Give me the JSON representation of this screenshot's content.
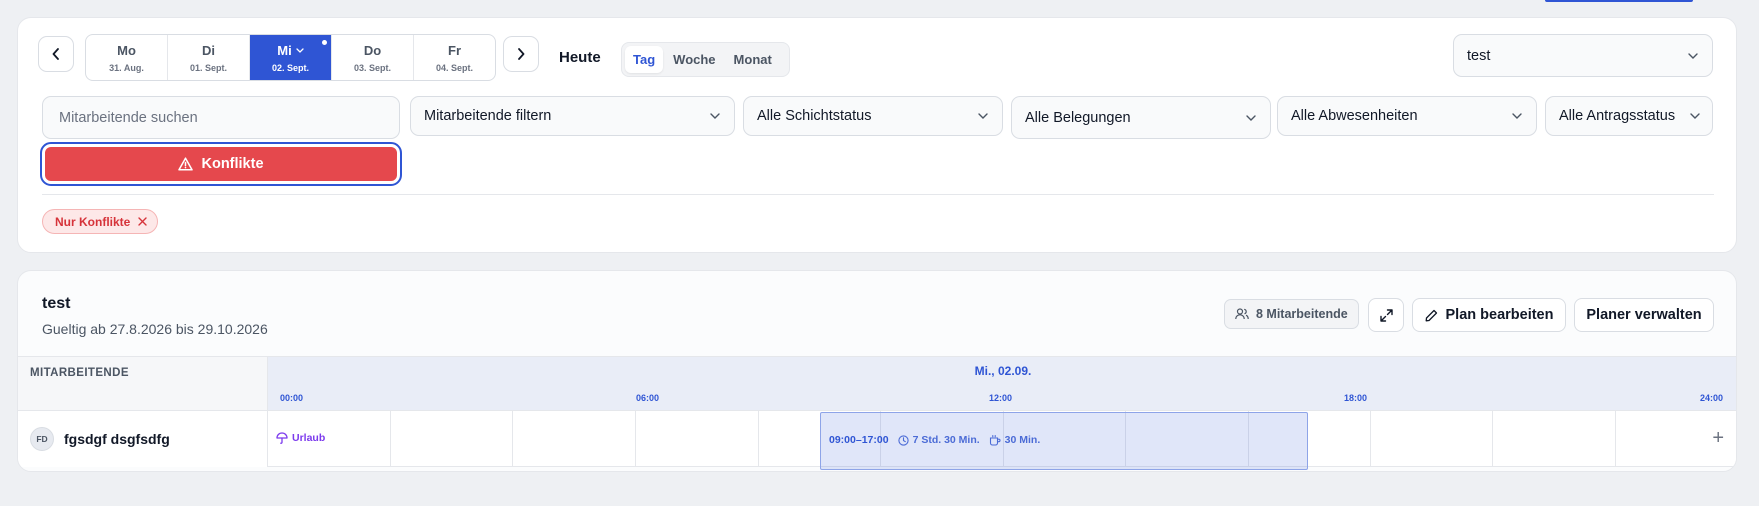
{
  "toolbar": {
    "days": [
      {
        "name": "Mo",
        "date": "31. Aug."
      },
      {
        "name": "Di",
        "date": "01. Sept."
      },
      {
        "name": "Mi",
        "date": "02. Sept."
      },
      {
        "name": "Do",
        "date": "03. Sept."
      },
      {
        "name": "Fr",
        "date": "04. Sept."
      }
    ],
    "active_day_index": 2,
    "today_label": "Heute",
    "views": [
      "Tag",
      "Woche",
      "Monat"
    ],
    "active_view": "Tag",
    "plan_select": "test"
  },
  "filters": {
    "search_placeholder": "Mitarbeitende suchen",
    "employees": "Mitarbeitende filtern",
    "shift_status": "Alle Schichtstatus",
    "assignments": "Alle Belegungen",
    "absences": "Alle Abwesenheiten",
    "request_status": "Alle Antragsstatus",
    "conflicts_button": "Konflikte",
    "active_chip": "Nur Konflikte"
  },
  "plan": {
    "title": "test",
    "validity": "Gueltig ab 27.8.2026 bis 29.10.2026",
    "employee_count": "8 Mitarbeitende",
    "edit_label": "Plan bearbeiten",
    "manage_label": "Planer verwalten"
  },
  "grid": {
    "left_header": "MITARBEITENDE",
    "day_label": "Mi., 02.09.",
    "hours": [
      "00:00",
      "06:00",
      "12:00",
      "18:00",
      "24:00"
    ],
    "rows": [
      {
        "initials": "FD",
        "name": "fgsdgf dsgfsdfg",
        "absence": "Urlaub",
        "shift": {
          "time": "09:00–17:00",
          "duration": "7 Std. 30 Min.",
          "break": "30 Min."
        }
      }
    ]
  },
  "colors": {
    "accent": "#2f55d4",
    "danger": "#e5484d",
    "absence": "#7c3aed"
  }
}
